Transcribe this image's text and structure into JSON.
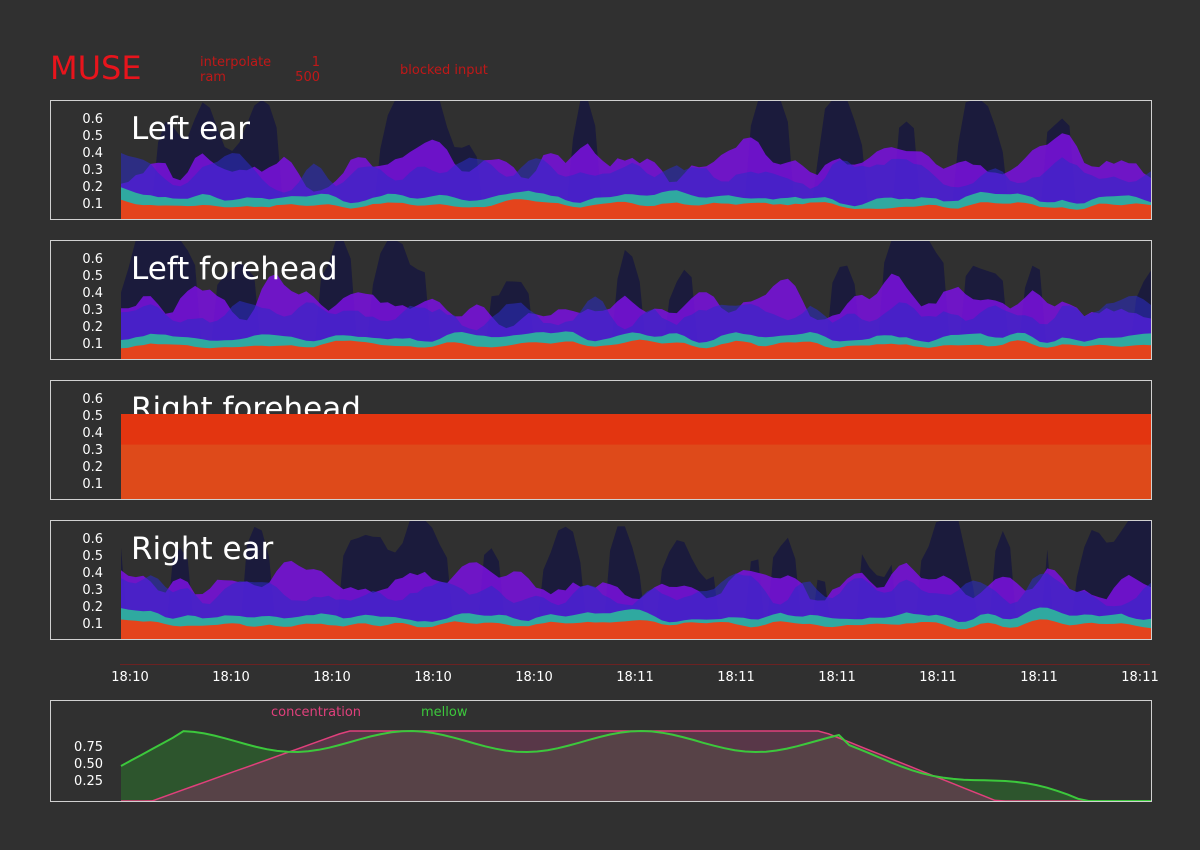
{
  "app": {
    "title": "MUSE"
  },
  "stats": [
    {
      "label": "interpolate",
      "value": "1"
    },
    {
      "label": "ram",
      "value": "500"
    }
  ],
  "status": {
    "text": "blocked input"
  },
  "colors": {
    "background": "#303030",
    "title": "#e8141c",
    "band_1": "#e4441c",
    "band_2": "#2fa9a0",
    "band_3": "#2c2cc8",
    "band_4": "#7a10e0",
    "band_5": "#1b1b3c",
    "concentration": "#e0407c",
    "mellow": "#3cc83c"
  },
  "panels": [
    {
      "key": "left_ear",
      "label": "Left ear"
    },
    {
      "key": "left_forehead",
      "label": "Left forehead"
    },
    {
      "key": "right_forehead",
      "label": "Right forehead"
    },
    {
      "key": "right_ear",
      "label": "Right ear"
    }
  ],
  "y_ticks": [
    "0.6",
    "0.5",
    "0.4",
    "0.3",
    "0.2",
    "0.1"
  ],
  "time_axis": {
    "labels": [
      "18:10",
      "18:10",
      "18:10",
      "18:10",
      "18:10",
      "18:11",
      "18:11",
      "18:11",
      "18:11",
      "18:11",
      "18:11"
    ]
  },
  "mood": {
    "legend": {
      "concentration": "concentration",
      "mellow": "mellow"
    },
    "y_ticks": [
      "0.75",
      "0.50",
      "0.25"
    ]
  }
}
